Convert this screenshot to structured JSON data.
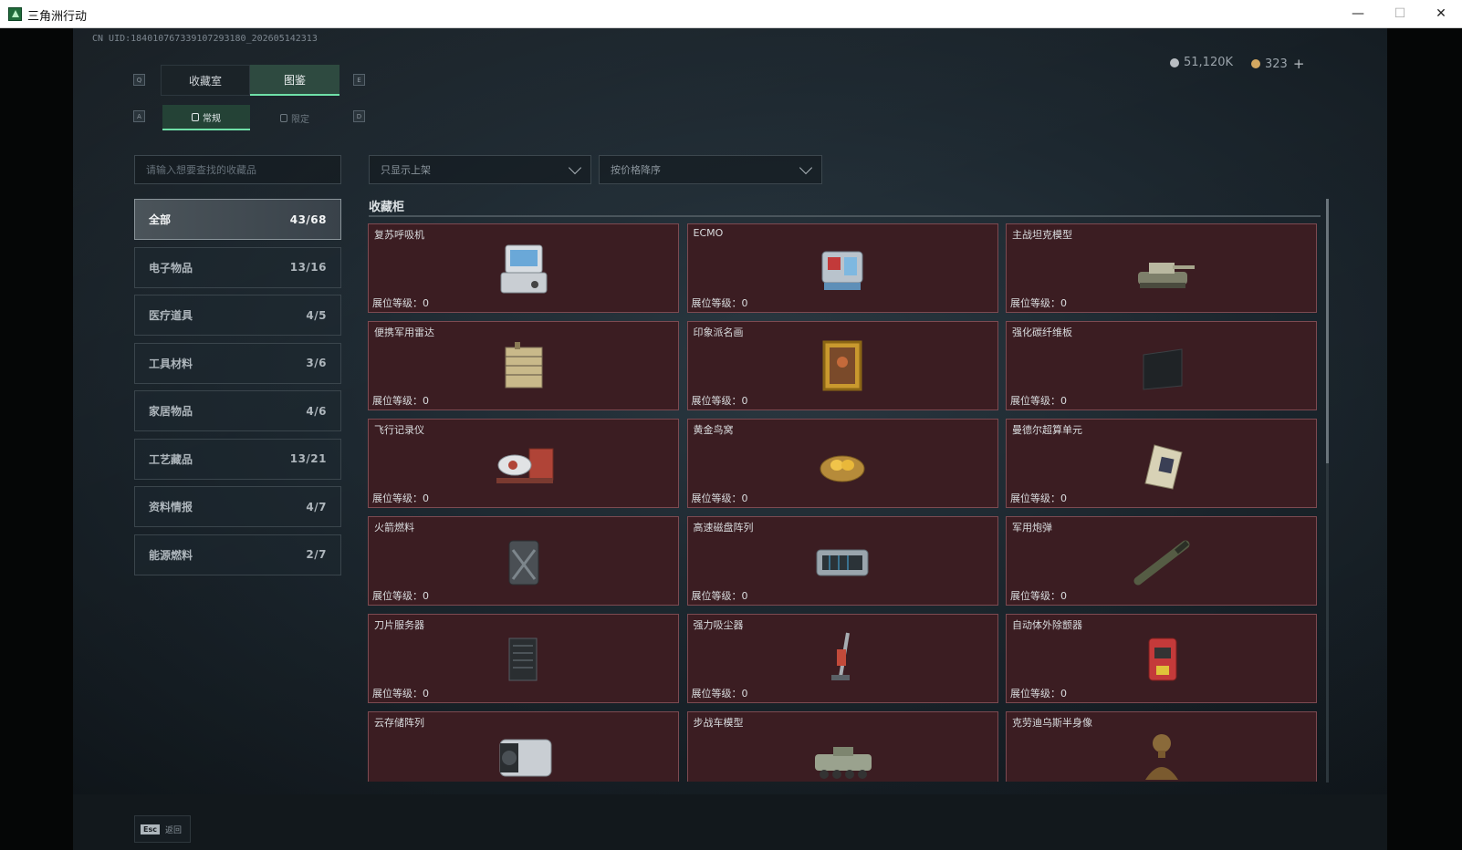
{
  "window": {
    "title": "三角洲行动"
  },
  "uid": "CN UID:18401076733910729318­0_202605142313",
  "currency": {
    "silver": "51,120K",
    "gold": "323",
    "add": "+"
  },
  "tabs": {
    "collection_room": "收藏室",
    "atlas": "图鉴"
  },
  "subtabs": {
    "normal": "常规",
    "limited": "限定"
  },
  "hotkeys": {
    "prev_tab": "Q",
    "next_tab": "E",
    "prev_sub": "A",
    "next_sub": "D"
  },
  "search": {
    "placeholder": "请输入想要查找的收藏品",
    "value": ""
  },
  "filter": {
    "label": "只显示上架"
  },
  "sort": {
    "label": "按价格降序"
  },
  "categories": [
    {
      "label": "全部",
      "count": "43/68"
    },
    {
      "label": "电子物品",
      "count": "13/16"
    },
    {
      "label": "医疗道具",
      "count": "4/5"
    },
    {
      "label": "工具材料",
      "count": "3/6"
    },
    {
      "label": "家居物品",
      "count": "4/6"
    },
    {
      "label": "工艺藏品",
      "count": "13/21"
    },
    {
      "label": "资料情报",
      "count": "4/7"
    },
    {
      "label": "能源燃料",
      "count": "2/7"
    }
  ],
  "section": {
    "title": "收藏柜"
  },
  "items": [
    {
      "name": "复苏呼吸机",
      "level": "展位等级：0",
      "icon": "ventilator-icon"
    },
    {
      "name": "ECMO",
      "level": "展位等级：0",
      "icon": "ecmo-icon"
    },
    {
      "name": "主战坦克模型",
      "level": "展位等级：0",
      "icon": "tank-model-icon"
    },
    {
      "name": "便携军用雷达",
      "level": "展位等级：0",
      "icon": "radar-icon"
    },
    {
      "name": "印象派名画",
      "level": "展位等级：0",
      "icon": "painting-icon"
    },
    {
      "name": "强化碳纤维板",
      "level": "展位等级：0",
      "icon": "carbon-plate-icon"
    },
    {
      "name": "飞行记录仪",
      "level": "展位等级：0",
      "icon": "flight-recorder-icon"
    },
    {
      "name": "黄金鸟窝",
      "level": "展位等级：0",
      "icon": "golden-nest-icon"
    },
    {
      "name": "曼德尔超算单元",
      "level": "展位等级：0",
      "icon": "supercompute-unit-icon"
    },
    {
      "name": "火箭燃料",
      "level": "展位等级：0",
      "icon": "fuel-can-icon"
    },
    {
      "name": "高速磁盘阵列",
      "level": "展位等级：0",
      "icon": "disk-array-icon"
    },
    {
      "name": "军用炮弹",
      "level": "展位等级：0",
      "icon": "shell-icon"
    },
    {
      "name": "刀片服务器",
      "level": "展位等级：0",
      "icon": "blade-server-icon"
    },
    {
      "name": "强力吸尘器",
      "level": "展位等级：0",
      "icon": "vacuum-icon"
    },
    {
      "name": "自动体外除颤器",
      "level": "展位等级：0",
      "icon": "defibrillator-icon"
    },
    {
      "name": "云存储阵列",
      "level": "",
      "icon": "cloud-storage-icon"
    },
    {
      "name": "步战车模型",
      "level": "",
      "icon": "ifv-model-icon"
    },
    {
      "name": "克劳迪乌斯半身像",
      "level": "",
      "icon": "bust-icon"
    }
  ],
  "footer": {
    "esc_key": "Esc",
    "esc_label": "返回"
  }
}
